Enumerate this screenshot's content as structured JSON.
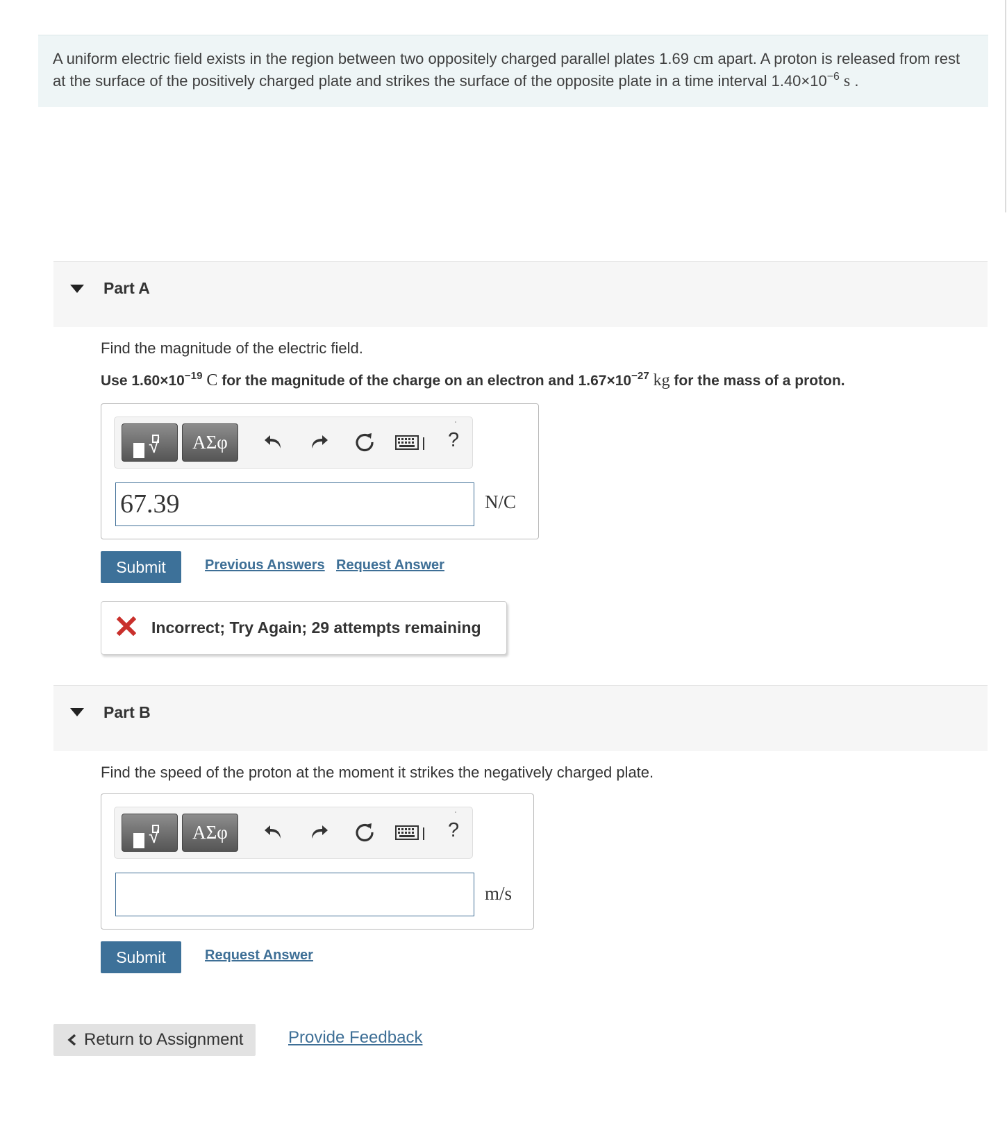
{
  "intro": {
    "line1_a": "A uniform electric field exists in the region between two oppositely charged parallel plates 1.69",
    "line1_unit": "cm",
    "line1_b": "apart. A proton is released from rest",
    "line2_a": "at the surface of the positively charged plate and strikes the surface of the opposite plate in a time interval 1.40×10",
    "line2_exp": "−6",
    "line2_unit": "s",
    "line2_end": "."
  },
  "part_a": {
    "title": "Part A",
    "prompt": "Find the magnitude of the electric field.",
    "hint": {
      "a": "Use 1.60×10",
      "exp1": "−19",
      "unit1": "C",
      "b": "for the magnitude of the charge on an electron and 1.67×10",
      "exp2": "−27",
      "unit2": "kg",
      "c": "for the mass of a proton."
    },
    "toolbar": {
      "symbols_label": "ΑΣφ",
      "help_label": "?"
    },
    "answer_value": "67.39",
    "unit": "N/C",
    "submit_label": "Submit",
    "previous_answers_label": "Previous Answers",
    "request_answer_label": "Request Answer",
    "feedback_text": "Incorrect; Try Again; 29 attempts remaining"
  },
  "part_b": {
    "title": "Part B",
    "prompt": "Find the speed of the proton at the moment it strikes the negatively charged plate.",
    "toolbar": {
      "symbols_label": "ΑΣφ",
      "help_label": "?"
    },
    "answer_value": "",
    "unit": "m/s",
    "submit_label": "Submit",
    "request_answer_label": "Request Answer"
  },
  "footer": {
    "return_label": "Return to Assignment",
    "feedback_label": "Provide Feedback"
  },
  "colors": {
    "accent_blue": "#3d7199",
    "link_blue": "#3e6f96",
    "error_red": "#c9302c",
    "intro_bg": "#eef5f6"
  }
}
